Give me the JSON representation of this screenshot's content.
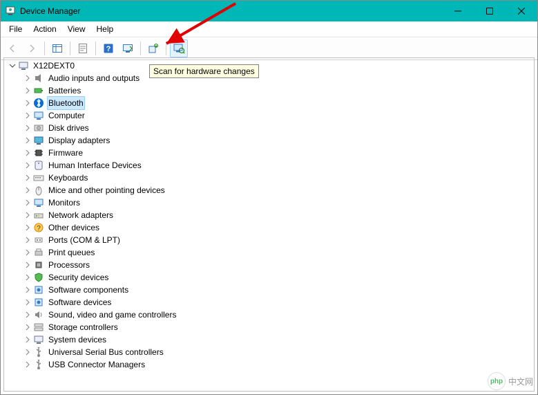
{
  "window": {
    "title": "Device Manager"
  },
  "menu": {
    "items": [
      "File",
      "Action",
      "View",
      "Help"
    ]
  },
  "toolbar": {
    "buttons": [
      {
        "name": "back",
        "enabled": false
      },
      {
        "name": "forward",
        "enabled": false
      },
      {
        "sep": true
      },
      {
        "name": "show-hide-tree"
      },
      {
        "sep": true
      },
      {
        "name": "properties"
      },
      {
        "sep": true
      },
      {
        "name": "help"
      },
      {
        "name": "view-devices"
      },
      {
        "sep": true
      },
      {
        "name": "update-driver"
      },
      {
        "sep": true
      },
      {
        "name": "scan-hardware",
        "hover": true
      }
    ]
  },
  "tooltip": "Scan for hardware changes",
  "tree": {
    "root": {
      "label": "X12DEXT0",
      "icon": "computer",
      "expanded": true
    },
    "children": [
      {
        "label": "Audio inputs and outputs",
        "icon": "audio"
      },
      {
        "label": "Batteries",
        "icon": "battery"
      },
      {
        "label": "Bluetooth",
        "icon": "bluetooth",
        "selected": true
      },
      {
        "label": "Computer",
        "icon": "monitor"
      },
      {
        "label": "Disk drives",
        "icon": "disk"
      },
      {
        "label": "Display adapters",
        "icon": "display"
      },
      {
        "label": "Firmware",
        "icon": "chip"
      },
      {
        "label": "Human Interface Devices",
        "icon": "hid"
      },
      {
        "label": "Keyboards",
        "icon": "keyboard"
      },
      {
        "label": "Mice and other pointing devices",
        "icon": "mouse"
      },
      {
        "label": "Monitors",
        "icon": "monitor"
      },
      {
        "label": "Network adapters",
        "icon": "network"
      },
      {
        "label": "Other devices",
        "icon": "other"
      },
      {
        "label": "Ports (COM & LPT)",
        "icon": "port"
      },
      {
        "label": "Print queues",
        "icon": "printer"
      },
      {
        "label": "Processors",
        "icon": "cpu"
      },
      {
        "label": "Security devices",
        "icon": "security"
      },
      {
        "label": "Software components",
        "icon": "software"
      },
      {
        "label": "Software devices",
        "icon": "software"
      },
      {
        "label": "Sound, video and game controllers",
        "icon": "sound"
      },
      {
        "label": "Storage controllers",
        "icon": "storage"
      },
      {
        "label": "System devices",
        "icon": "system"
      },
      {
        "label": "Universal Serial Bus controllers",
        "icon": "usb"
      },
      {
        "label": "USB Connector Managers",
        "icon": "usb"
      }
    ]
  },
  "watermark": "中文网"
}
